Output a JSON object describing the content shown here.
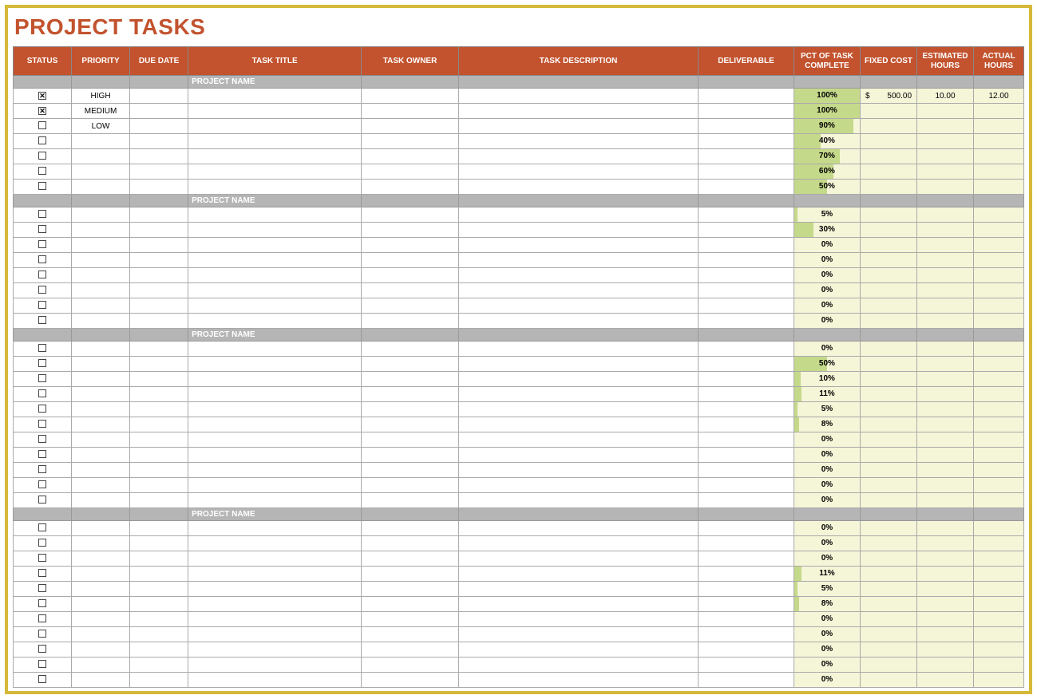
{
  "title": "PROJECT TASKS",
  "columns": [
    "STATUS",
    "PRIORITY",
    "DUE DATE",
    "TASK TITLE",
    "TASK OWNER",
    "TASK DESCRIPTION",
    "DELIVERABLE",
    "PCT OF TASK COMPLETE",
    "FIXED COST",
    "ESTIMATED HOURS",
    "ACTUAL HOURS"
  ],
  "group_label": "PROJECT NAME",
  "groups": [
    {
      "rows": [
        {
          "checked": true,
          "priority": "HIGH",
          "pct": 100,
          "cost": "500.00",
          "est": "10.00",
          "act": "12.00"
        },
        {
          "checked": true,
          "priority": "MEDIUM",
          "pct": 100
        },
        {
          "checked": false,
          "priority": "LOW",
          "pct": 90
        },
        {
          "checked": false,
          "pct": 40
        },
        {
          "checked": false,
          "pct": 70
        },
        {
          "checked": false,
          "pct": 60
        },
        {
          "checked": false,
          "pct": 50
        }
      ]
    },
    {
      "rows": [
        {
          "checked": false,
          "pct": 5
        },
        {
          "checked": false,
          "pct": 30
        },
        {
          "checked": false,
          "pct": 0
        },
        {
          "checked": false,
          "pct": 0
        },
        {
          "checked": false,
          "pct": 0
        },
        {
          "checked": false,
          "pct": 0
        },
        {
          "checked": false,
          "pct": 0
        },
        {
          "checked": false,
          "pct": 0
        }
      ]
    },
    {
      "rows": [
        {
          "checked": false,
          "pct": 0
        },
        {
          "checked": false,
          "pct": 50
        },
        {
          "checked": false,
          "pct": 10
        },
        {
          "checked": false,
          "pct": 11
        },
        {
          "checked": false,
          "pct": 5
        },
        {
          "checked": false,
          "pct": 8
        },
        {
          "checked": false,
          "pct": 0
        },
        {
          "checked": false,
          "pct": 0
        },
        {
          "checked": false,
          "pct": 0
        },
        {
          "checked": false,
          "pct": 0
        },
        {
          "checked": false,
          "pct": 0
        }
      ]
    },
    {
      "rows": [
        {
          "checked": false,
          "pct": 0
        },
        {
          "checked": false,
          "pct": 0
        },
        {
          "checked": false,
          "pct": 0
        },
        {
          "checked": false,
          "pct": 11
        },
        {
          "checked": false,
          "pct": 5
        },
        {
          "checked": false,
          "pct": 8
        },
        {
          "checked": false,
          "pct": 0
        },
        {
          "checked": false,
          "pct": 0
        },
        {
          "checked": false,
          "pct": 0
        },
        {
          "checked": false,
          "pct": 0
        },
        {
          "checked": false,
          "pct": 0
        }
      ]
    }
  ]
}
